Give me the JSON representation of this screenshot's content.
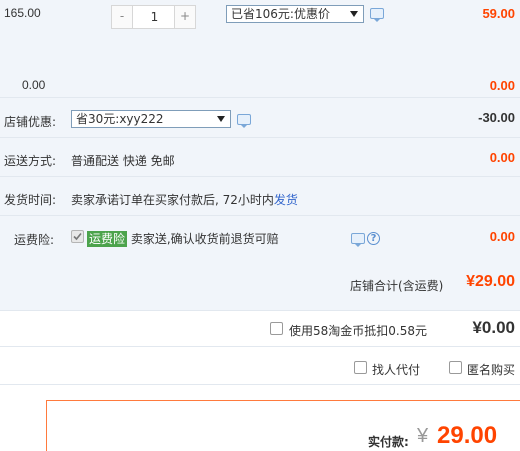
{
  "item": {
    "unit_price": "165.00",
    "quantity": "1",
    "minus_label": "-",
    "plus_label": "+",
    "promo_select": "已省106元:优惠价",
    "subtotal": "59.00",
    "discount_amount": "0.00",
    "discount_total": "0.00"
  },
  "shop_discount": {
    "label": "店铺优惠:",
    "select": "省30元:xyy222",
    "amount": "-30.00"
  },
  "shipping": {
    "label": "运送方式:",
    "value": "普通配送 快递 免邮",
    "amount": "0.00"
  },
  "delivery_time": {
    "label": "发货时间:",
    "text": "卖家承诺订单在买家付款后, 72小时内",
    "link": "发货"
  },
  "insurance": {
    "label": "运费险:",
    "tag": "运费险",
    "text": "卖家送,确认收货前退货可赔",
    "amount": "0.00",
    "help_glyph": "?"
  },
  "shop_total": {
    "label": "店铺合计(含运费)",
    "amount": "¥29.00"
  },
  "coins": {
    "label": "使用58淘金币抵扣0.58元",
    "amount": "¥0.00"
  },
  "options": {
    "proxy_pay": "找人代付",
    "anonymous": "匿名购买"
  },
  "payment": {
    "label": "实付款:",
    "currency": "¥",
    "amount": "29.00"
  },
  "colors": {
    "accent": "#ff4400",
    "panel_bg": "#f1f5fa",
    "link": "#3366cc",
    "insurance_tag": "#4ca34c"
  }
}
